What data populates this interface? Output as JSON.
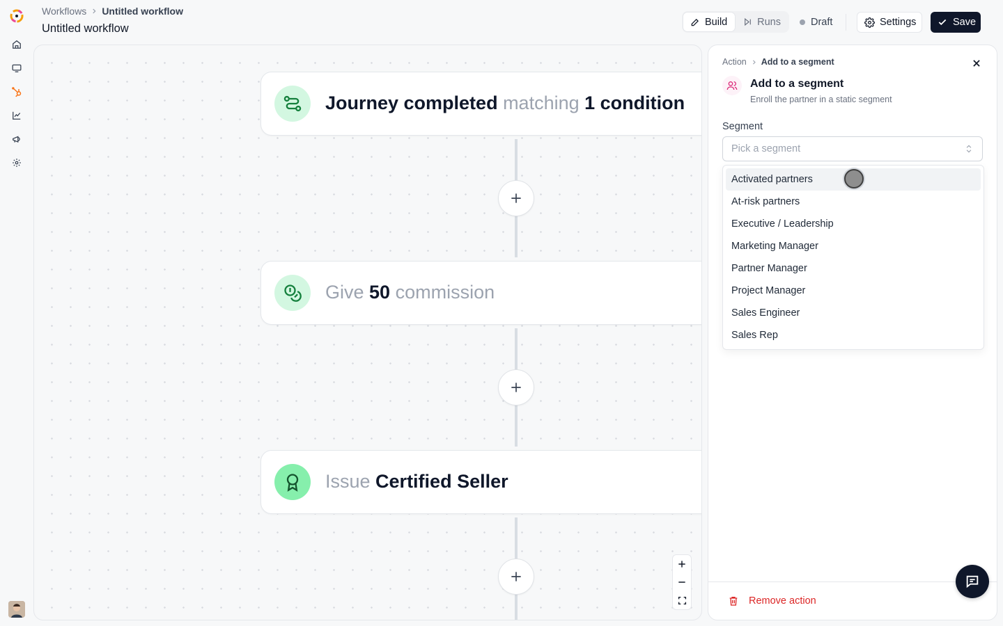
{
  "breadcrumb": {
    "parent": "Workflows",
    "current": "Untitled workflow"
  },
  "page_title": "Untitled workflow",
  "header": {
    "tabs": [
      {
        "label": "Build",
        "active": true
      },
      {
        "label": "Runs",
        "active": false
      }
    ],
    "status": "Draft",
    "settings_label": "Settings",
    "save_label": "Save"
  },
  "sidebar": {
    "items": [
      {
        "icon": "home-icon"
      },
      {
        "icon": "monitor-icon"
      },
      {
        "icon": "hubspot-icon"
      },
      {
        "icon": "chart-icon"
      },
      {
        "icon": "megaphone-icon"
      },
      {
        "icon": "gear-icon"
      }
    ]
  },
  "canvas": {
    "nodes": [
      {
        "icon": "route-icon",
        "parts": [
          {
            "text": "Journey completed",
            "style": "bold"
          },
          {
            "text": " matching ",
            "style": "muted"
          },
          {
            "text": "1 condition",
            "style": "bold"
          }
        ]
      },
      {
        "icon": "coins-icon",
        "parts": [
          {
            "text": "Give ",
            "style": "muted"
          },
          {
            "text": "50",
            "style": "bold"
          },
          {
            "text": " commission",
            "style": "muted"
          }
        ]
      },
      {
        "icon": "award-icon",
        "parts": [
          {
            "text": "Issue ",
            "style": "muted"
          },
          {
            "text": "Certified Seller",
            "style": "bold"
          }
        ]
      }
    ]
  },
  "panel": {
    "breadcrumb": {
      "parent": "Action",
      "current": "Add to a segment"
    },
    "title": "Add to a segment",
    "description": "Enroll the partner in a static segment",
    "field_label": "Segment",
    "select_placeholder": "Pick a segment",
    "options": [
      "Activated partners",
      "At-risk partners",
      "Executive / Leadership",
      "Marketing Manager",
      "Partner Manager",
      "Project Manager",
      "Sales Engineer",
      "Sales Rep"
    ],
    "hovered_option": 0,
    "remove_label": "Remove action"
  },
  "colors": {
    "accent": "#0f172a",
    "node_icon_bg": "#d3f7e1",
    "node_icon_fg": "#15803d",
    "danger": "#dc2626"
  }
}
